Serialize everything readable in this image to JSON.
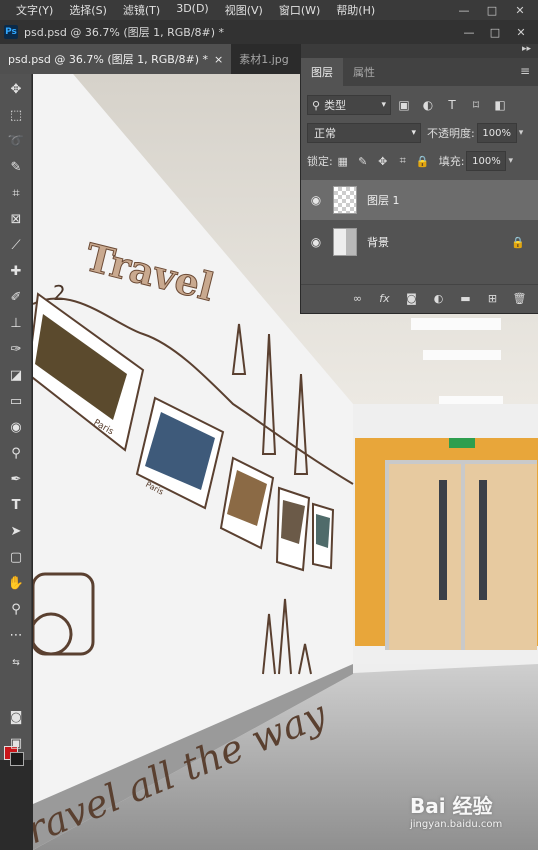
{
  "menubar": {
    "items": [
      "文字(Y)",
      "选择(S)",
      "滤镜(T)",
      "3D(D)",
      "视图(V)",
      "窗口(W)",
      "帮助(H)"
    ],
    "window_controls": [
      "—",
      "□",
      "✕"
    ]
  },
  "document": {
    "logo": "Ps",
    "title": "psd.psd @ 36.7% (图层 1, RGB/8#) *",
    "window_controls": [
      "—",
      "□",
      "✕"
    ]
  },
  "tabs": [
    {
      "label": "psd.psd @ 36.7% (图层 1, RGB/8#) *",
      "close": "×",
      "active": true
    },
    {
      "label": "素材1.jpg",
      "active": false
    }
  ],
  "layers_panel": {
    "tabs": [
      "图层",
      "属性"
    ],
    "filter": {
      "value": "类型"
    },
    "blend_mode": "正常",
    "opacity_label": "不透明度:",
    "opacity_value": "100%",
    "lock_label": "锁定:",
    "fill_label": "填充:",
    "fill_value": "100%",
    "layers": [
      {
        "name": "图层 1",
        "selected": true
      },
      {
        "name": "背景",
        "locked": true
      }
    ]
  },
  "artwork": {
    "title": "Travel",
    "number": "2",
    "tagline": "ravel all the way",
    "photo_captions": [
      "Paris",
      "Paris"
    ]
  },
  "watermark": {
    "brand": "Bai 经验",
    "sub": "jingyan.baidu.com"
  },
  "colors": {
    "foreground": "#c8161a",
    "background": "#1c1c1c",
    "accent_wall": "#e8a63a",
    "door": "#e7caa0"
  }
}
